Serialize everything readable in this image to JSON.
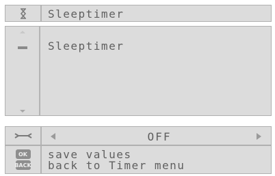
{
  "title_bar": {
    "icon": "clock-icon",
    "title": "Sleeptimer"
  },
  "content": {
    "heading": "Sleeptimer",
    "scroll_icons": [
      "scroll-up-icon",
      "scroll-down-icon"
    ]
  },
  "option": {
    "icon": "wrench-icon",
    "value": "OFF"
  },
  "help": {
    "ok_key": "OK",
    "back_key": "BACK",
    "ok_text": "save values",
    "back_text": "back to Timer menu"
  }
}
